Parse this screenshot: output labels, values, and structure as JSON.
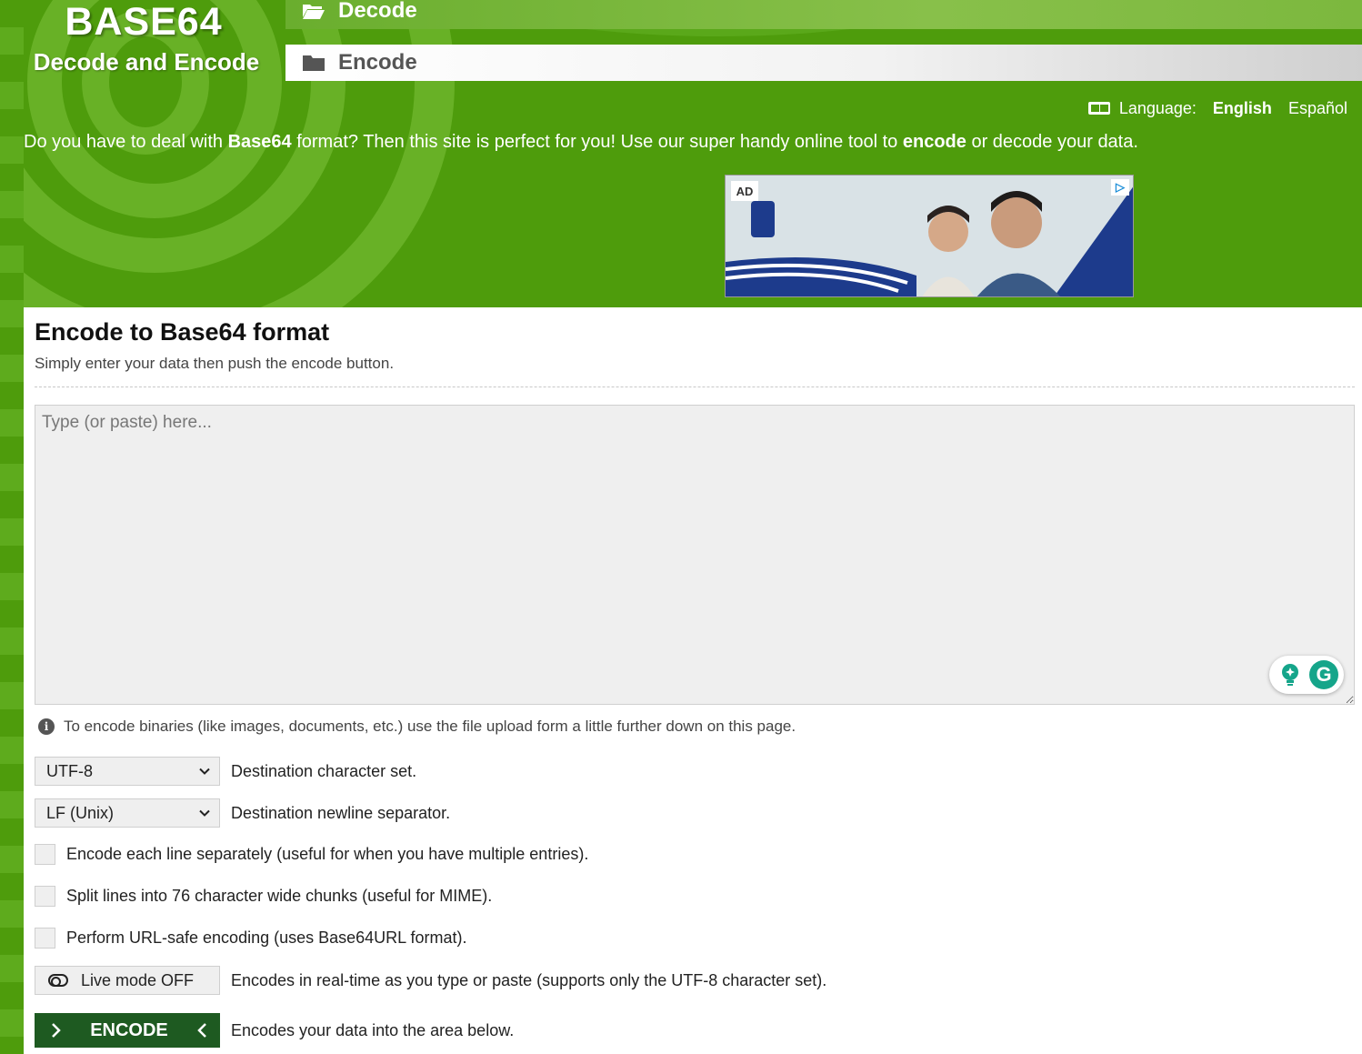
{
  "brand": {
    "title": "BASE64",
    "subtitle": "Decode and Encode"
  },
  "nav": {
    "decode_label": "Decode",
    "encode_label": "Encode"
  },
  "language": {
    "label": "Language:",
    "options": [
      "English",
      "Español"
    ],
    "selected": "English"
  },
  "intro": {
    "part1": "Do you have to deal with ",
    "bold1": "Base64",
    "part2": " format? Then this site is perfect for you! Use our super handy online tool to ",
    "bold2": "encode",
    "part3": " or decode your data."
  },
  "ad": {
    "badge": "AD",
    "choice": "▷"
  },
  "main": {
    "title": "Encode to Base64 format",
    "subtitle": "Simply enter your data then push the encode button.",
    "input_placeholder": "Type (or paste) here...",
    "info_text": "To encode binaries (like images, documents, etc.) use the file upload form a little further down on this page."
  },
  "options": {
    "charset": {
      "value": "UTF-8",
      "desc": "Destination character set."
    },
    "newline": {
      "value": "LF (Unix)",
      "desc": "Destination newline separator."
    },
    "each_line": {
      "checked": false,
      "label": "Encode each line separately (useful for when you have multiple entries)."
    },
    "split_lines": {
      "checked": false,
      "label": "Split lines into 76 character wide chunks (useful for MIME)."
    },
    "url_safe": {
      "checked": false,
      "label": "Perform URL-safe encoding (uses Base64URL format)."
    },
    "live_mode": {
      "label": "Live mode OFF",
      "desc": "Encodes in real-time as you type or paste (supports only the UTF-8 character set)."
    },
    "encode": {
      "label": "ENCODE",
      "desc": "Encodes your data into the area below."
    }
  },
  "grammarly": {
    "letter": "G"
  },
  "colors": {
    "header_green": "#4e9c0c",
    "swirl_green": "#68b126",
    "encode_button": "#1e5a21",
    "grammarly_teal": "#15a58a"
  }
}
